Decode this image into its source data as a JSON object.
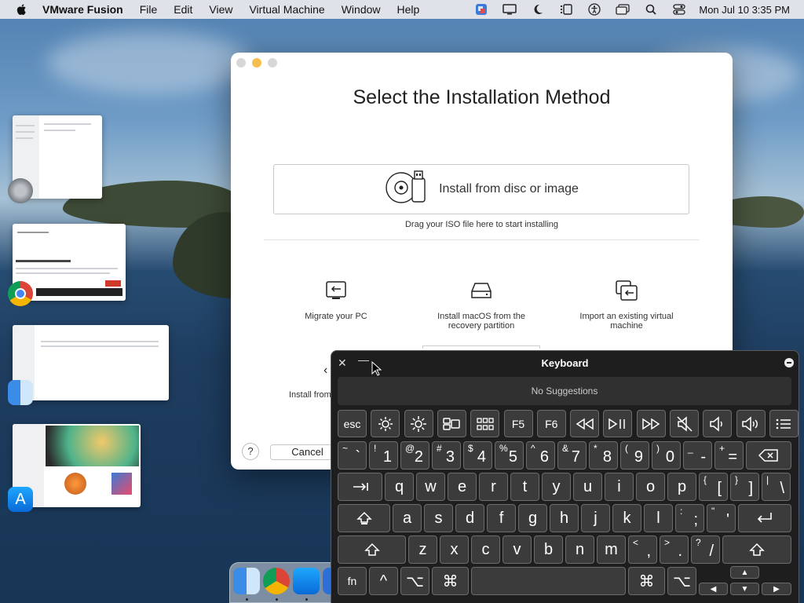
{
  "menubar": {
    "app_name": "VMware Fusion",
    "menus": [
      "File",
      "Edit",
      "View",
      "Virtual Machine",
      "Window",
      "Help"
    ],
    "clock": "Mon Jul 10  3:35 PM"
  },
  "dialog": {
    "title": "Select the Installation Method",
    "disc_option": "Install from disc or image",
    "drag_hint": "Drag your ISO file here to start installing",
    "options": [
      {
        "label": "Migrate your PC"
      },
      {
        "label": "Install macOS from the recovery partition"
      },
      {
        "label": "Import an existing virtual machine"
      }
    ],
    "partial_option": "Install from",
    "help_label": "?",
    "cancel_label": "Cancel"
  },
  "keyboard": {
    "title": "Keyboard",
    "close": "✕",
    "minimize": "—",
    "suggestions": "No Suggestions",
    "fn_row": [
      "esc",
      "",
      "",
      "",
      "",
      "F5",
      "F6",
      "",
      "",
      "",
      "",
      "",
      "",
      ""
    ],
    "number_row": [
      {
        "up": "~",
        "dn": "`"
      },
      {
        "up": "!",
        "dn": "1"
      },
      {
        "up": "@",
        "dn": "2"
      },
      {
        "up": "#",
        "dn": "3"
      },
      {
        "up": "$",
        "dn": "4"
      },
      {
        "up": "%",
        "dn": "5"
      },
      {
        "up": "^",
        "dn": "6"
      },
      {
        "up": "&",
        "dn": "7"
      },
      {
        "up": "*",
        "dn": "8"
      },
      {
        "up": "(",
        "dn": "9"
      },
      {
        "up": ")",
        "dn": "0"
      },
      {
        "up": "_",
        "dn": "-"
      },
      {
        "up": "+",
        "dn": "="
      }
    ],
    "row_q": [
      "q",
      "w",
      "e",
      "r",
      "t",
      "y",
      "u",
      "i",
      "o",
      "p"
    ],
    "row_q_sym": [
      {
        "up": "{",
        "dn": "["
      },
      {
        "up": "}",
        "dn": "]"
      },
      {
        "up": "|",
        "dn": "\\"
      }
    ],
    "row_a": [
      "a",
      "s",
      "d",
      "f",
      "g",
      "h",
      "j",
      "k",
      "l"
    ],
    "row_a_sym": [
      {
        "up": ":",
        "dn": ";"
      },
      {
        "up": "\"",
        "dn": "'"
      }
    ],
    "row_z": [
      "z",
      "x",
      "c",
      "v",
      "b",
      "n",
      "m"
    ],
    "row_z_sym": [
      {
        "up": "<",
        "dn": ","
      },
      {
        "up": ">",
        "dn": "."
      },
      {
        "up": "?",
        "dn": "/"
      }
    ],
    "bottom": {
      "fn": "fn",
      "ctrl": "^",
      "opt": "⌥",
      "cmd": "⌘"
    },
    "arrows": {
      "up": "▲",
      "down": "▼",
      "left": "◀",
      "right": "▶"
    }
  },
  "colors": {
    "close": "#ed6a5e",
    "minimize": "#f5bf4f",
    "zoom": "#c8c8c8"
  }
}
